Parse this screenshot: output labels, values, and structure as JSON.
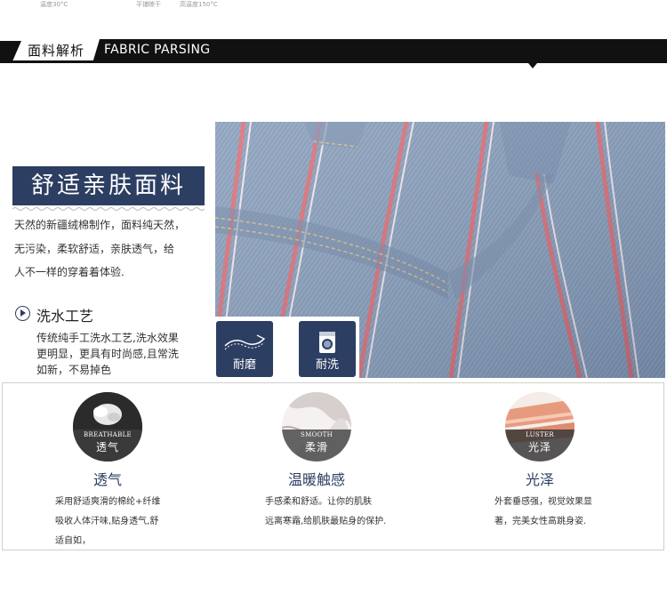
{
  "top_fragments": [
    "温度30°C",
    "平铺晾干",
    "高温度150°C"
  ],
  "header": {
    "cn": "面料解析",
    "en": "FABRIC PARSING"
  },
  "comfort": {
    "title": "舒适亲肤面料",
    "lines": [
      "天然的新疆绒棉制作，面料纯天然，",
      "无污染，柔软舒适，亲肤透气，给",
      "人不一样的穿着着体验."
    ]
  },
  "wash": {
    "title": "洗水工艺",
    "lines": [
      "传统纯手工洗水工艺,洗水效果",
      "更明显，更具有时尚感,且常洗",
      "如新，不易掉色"
    ]
  },
  "badges": [
    {
      "label": "耐磨",
      "icon": "wear-resistant-icon"
    },
    {
      "label": "耐洗",
      "icon": "washing-machine-icon"
    }
  ],
  "features": [
    {
      "en": "BREATHABLE",
      "cn": "透气",
      "title": "透气",
      "lines": [
        "采用舒适爽滑的棉纶+纤维",
        "吸收人体汗味,贴身透气,舒",
        "适自如，"
      ]
    },
    {
      "en": "SMOOTH",
      "cn": "柔滑",
      "title": "温暖触感",
      "lines": [
        "手感柔和舒适。让你的肌肤",
        "远离寒霜,给肌肤最贴身的保护."
      ]
    },
    {
      "en": "LUSTER",
      "cn": "光泽",
      "title": "光泽",
      "lines": [
        "外套垂感强，视觉效果显",
        "著，完美女性高跳身姿."
      ]
    }
  ],
  "colors": {
    "navy": "#2c3e62",
    "denim": "#8ea3bf",
    "stripe": "#d96f78"
  }
}
